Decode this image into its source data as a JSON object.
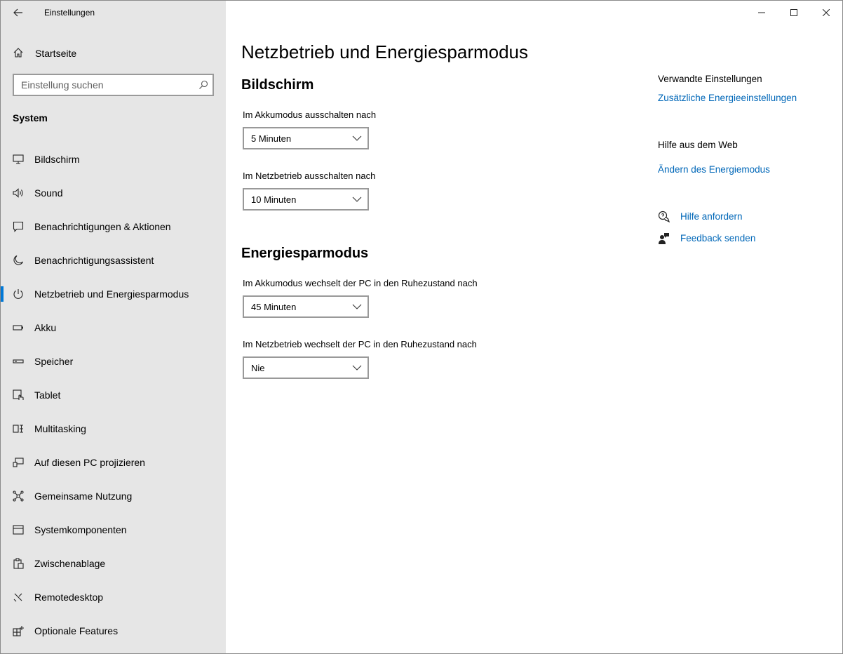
{
  "window": {
    "app_title": "Einstellungen"
  },
  "sidebar": {
    "home_label": "Startseite",
    "search_placeholder": "Einstellung suchen",
    "section_label": "System",
    "items": [
      {
        "label": "Bildschirm",
        "icon": "monitor-icon"
      },
      {
        "label": "Sound",
        "icon": "speaker-icon"
      },
      {
        "label": "Benachrichtigungen & Aktionen",
        "icon": "notification-icon"
      },
      {
        "label": "Benachrichtigungsassistent",
        "icon": "moon-icon"
      },
      {
        "label": "Netzbetrieb und Energiesparmodus",
        "icon": "power-icon",
        "active": true
      },
      {
        "label": "Akku",
        "icon": "battery-icon"
      },
      {
        "label": "Speicher",
        "icon": "storage-icon"
      },
      {
        "label": "Tablet",
        "icon": "tablet-icon"
      },
      {
        "label": "Multitasking",
        "icon": "multitasking-icon"
      },
      {
        "label": "Auf diesen PC projizieren",
        "icon": "project-icon"
      },
      {
        "label": "Gemeinsame Nutzung",
        "icon": "share-icon"
      },
      {
        "label": "Systemkomponenten",
        "icon": "components-icon"
      },
      {
        "label": "Zwischenablage",
        "icon": "clipboard-icon"
      },
      {
        "label": "Remotedesktop",
        "icon": "remote-icon"
      },
      {
        "label": "Optionale Features",
        "icon": "features-icon"
      }
    ]
  },
  "main": {
    "title": "Netzbetrieb und Energiesparmodus",
    "screen": {
      "heading": "Bildschirm",
      "battery_label": "Im Akkumodus ausschalten nach",
      "battery_value": "5 Minuten",
      "ac_label": "Im Netzbetrieb ausschalten nach",
      "ac_value": "10 Minuten"
    },
    "sleep": {
      "heading": "Energiesparmodus",
      "battery_label": "Im Akkumodus wechselt der PC in den Ruhezustand nach",
      "battery_value": "45 Minuten",
      "ac_label": "Im Netzbetrieb wechselt der PC in den Ruhezustand nach",
      "ac_value": "Nie"
    }
  },
  "aside": {
    "related_heading": "Verwandte Einstellungen",
    "related_link": "Zusätzliche Energieeinstellungen",
    "web_heading": "Hilfe aus dem Web",
    "web_link": "Ändern des Energiemodus",
    "help_label": "Hilfe anfordern",
    "feedback_label": "Feedback senden"
  },
  "colors": {
    "accent": "#0078d7",
    "link": "#0067b8",
    "sidebar_bg": "#e6e6e6"
  }
}
